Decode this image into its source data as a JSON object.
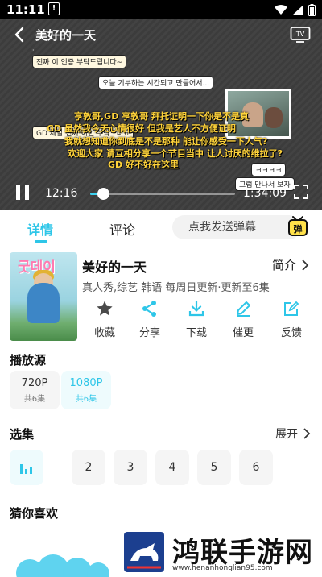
{
  "status_bar": {
    "time": "11:11",
    "warning_glyph": "!"
  },
  "player": {
    "title": "美好的一天",
    "current_time": "12:16",
    "duration": "1:34:09",
    "progress": 0.09,
    "chat_bubbles": [
      "진짜 이 인증 부탁드립니다~",
      "오늘 기부하는 시간되고 만들어서...",
      "GD 제발 진짜 이런 부탁드려요",
      "ㅋㅋㅋㅋ",
      "그럼 만나서 보자"
    ],
    "danmu": [
      "亨敦哥,GD 亨敦哥 拜托证明一下你是不是真",
      "GD 虽然我今天心情很好 但我是艺人不方便证明",
      "我就想知道你到底是不是那种 能让你感受一下人气?",
      "欢迎大家 请互相分享一个节目当中 让人讨厌的维拉了?",
      "GD 好不好在这里"
    ]
  },
  "tabs": [
    {
      "label": "详情",
      "active": true
    },
    {
      "label": "评论",
      "active": false
    }
  ],
  "danmu_input": {
    "placeholder": "点我发送弹幕"
  },
  "danmu_toggle": {
    "label": "弹"
  },
  "show": {
    "poster_title": "굿데이",
    "title": "美好的一天",
    "intro_label": "简介",
    "meta": "真人秀,综艺  韩语  每周日更新·更新至6集"
  },
  "actions": [
    {
      "label": "收藏",
      "icon": "star-icon"
    },
    {
      "label": "分享",
      "icon": "share-icon"
    },
    {
      "label": "下载",
      "icon": "download-icon"
    },
    {
      "label": "催更",
      "icon": "pen-icon"
    },
    {
      "label": "反馈",
      "icon": "feedback-icon"
    }
  ],
  "sources": {
    "title": "播放源",
    "items": [
      {
        "quality": "720P",
        "count": "共6集",
        "active": false
      },
      {
        "quality": "1080P",
        "count": "共6集",
        "active": true
      }
    ]
  },
  "episodes": {
    "title": "选集",
    "expand_label": "展开",
    "items": [
      "1",
      "2",
      "3",
      "4",
      "5",
      "6"
    ],
    "current": "1"
  },
  "recommend": {
    "title": "猜你喜欢"
  },
  "watermark": {
    "text": "鸿联手游网",
    "url": "www.henanhonglian95.com"
  },
  "colors": {
    "accent": "#2ec6e8",
    "danmu": "#ffd33a"
  }
}
